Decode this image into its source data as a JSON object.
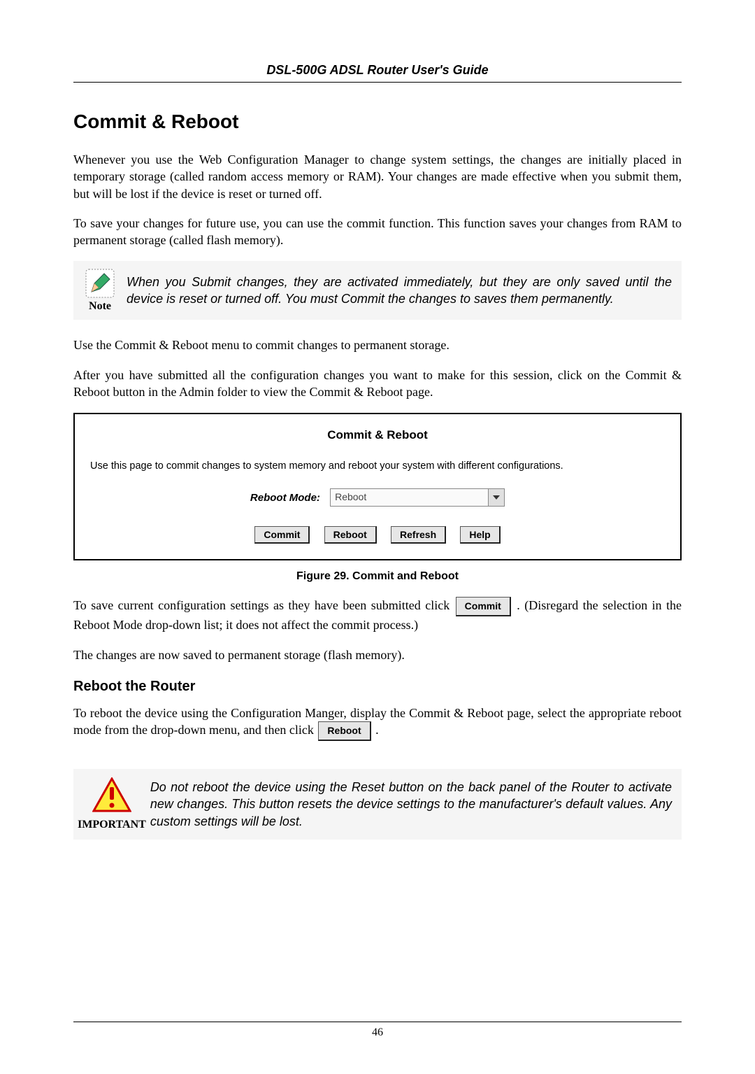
{
  "header": {
    "title": "DSL-500G ADSL Router User's Guide"
  },
  "section": {
    "heading": "Commit & Reboot",
    "p1": "Whenever you use the Web Configuration Manager to change system settings, the changes are initially placed in temporary storage (called random access memory or RAM). Your changes are made effective when you submit them, but will be lost if the device is reset or turned off.",
    "p2": "To save your changes for future use, you can use the commit function. This function saves your changes from RAM to permanent storage (called flash memory).",
    "note_label": "Note",
    "note_text": "When you Submit changes, they are activated immediately, but they are only saved until the device is reset or turned off. You must Commit the changes to saves them permanently.",
    "p3": "Use the Commit & Reboot menu to commit changes to permanent storage.",
    "p4": "After you have submitted all the configuration changes you want to make for this session, click on the Commit & Reboot button in the Admin folder to view the Commit & Reboot page."
  },
  "ui": {
    "title": "Commit & Reboot",
    "description": "Use this page to commit changes to system memory and reboot your system with different configurations.",
    "reboot_mode_label": "Reboot Mode:",
    "reboot_mode_value": "Reboot",
    "buttons": {
      "commit": "Commit",
      "reboot": "Reboot",
      "refresh": "Refresh",
      "help": "Help"
    }
  },
  "figure_caption": "Figure 29. Commit and Reboot",
  "after_figure": {
    "p5_before": "To save current configuration settings as they have been submitted click ",
    "commit_btn": "Commit",
    "p5_after": ". (Disregard the selection in the Reboot Mode drop-down list; it does not affect the commit process.)",
    "p6": "The changes are now saved to permanent storage (flash memory)."
  },
  "subsection": {
    "heading": "Reboot the Router",
    "p7_before": "To reboot the device using the Configuration Manger, display the Commit & Reboot page, select the appropriate reboot mode from the drop-down menu, and then click ",
    "reboot_btn": "Reboot",
    "p7_after": "."
  },
  "important": {
    "label": "IMPORTANT",
    "text": "Do not reboot the device using the Reset button on the back panel of the Router to activate new changes. This button resets the device settings to the manufacturer's default values. Any custom settings will be lost."
  },
  "page_number": "46"
}
